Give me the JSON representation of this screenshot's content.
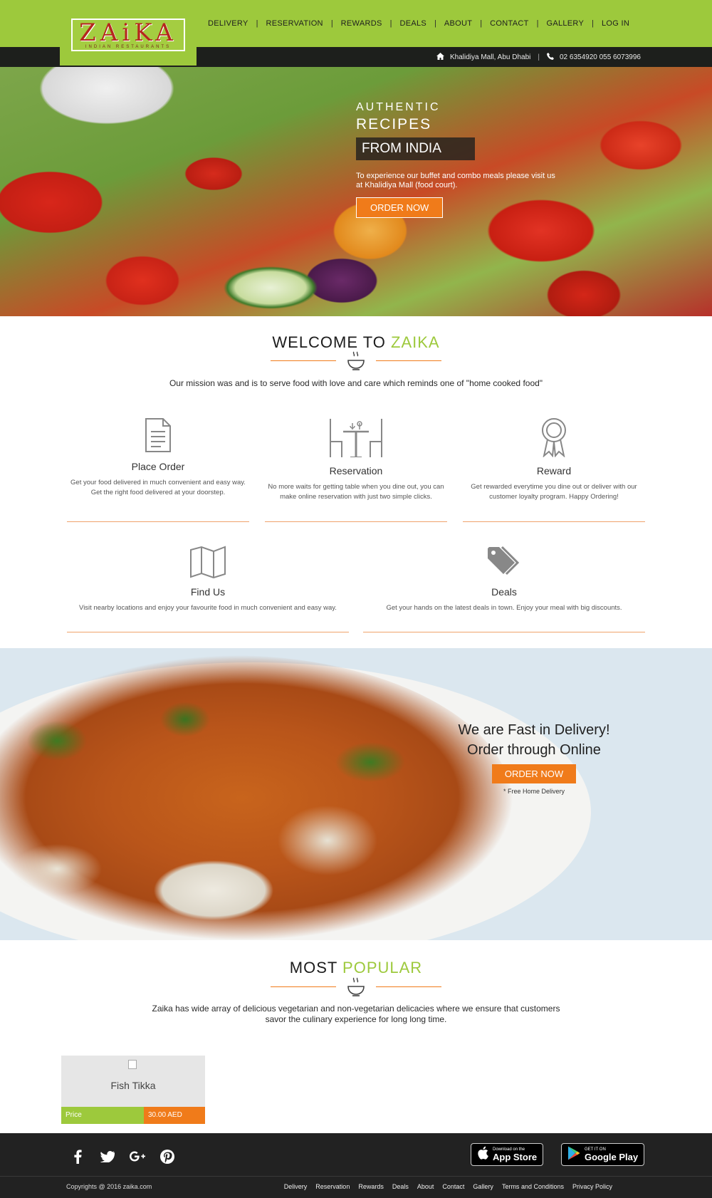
{
  "header": {
    "logo_title": "ZAiKA",
    "logo_subtitle": "INDIAN RESTAURANTS",
    "nav": [
      "DELIVERY",
      "RESERVATION",
      "REWARDS",
      "DEALS",
      "ABOUT",
      "CONTACT",
      "GALLERY",
      "LOG IN"
    ],
    "nav_separator": "|",
    "location": "Khalidiya Mall, Abu Dhabi",
    "info_separator": "|",
    "phone": "02 6354920  055 6073996",
    "colors": {
      "brand_green": "#9dc93c",
      "accent_orange": "#f07b1a",
      "dark": "#1d1f1c"
    }
  },
  "hero": {
    "line1": "AUTHENTIC",
    "line2": "RECIPES",
    "line3": "FROM INDIA",
    "description": "To experience our buffet and combo meals please visit us at Khalidiya Mall (food court).",
    "button": "ORDER NOW"
  },
  "welcome": {
    "title_a": "WELCOME TO ",
    "title_b": "ZAIKA",
    "mission": "Our mission was and is to serve food with love and care which reminds one of \"home cooked food\""
  },
  "features": [
    {
      "icon": "document-icon",
      "title": "Place Order",
      "desc": "Get your food delivered in much convenient and easy way. Get the right food delivered at your doorstep."
    },
    {
      "icon": "dining-table-icon",
      "title": "Reservation",
      "desc": "No more waits for getting table when you dine out, you can make online reservation with just two simple clicks."
    },
    {
      "icon": "award-ribbon-icon",
      "title": "Reward",
      "desc": "Get rewarded everytime you dine out or deliver with our customer loyalty program. Happy Ordering!"
    },
    {
      "icon": "map-icon",
      "title": "Find Us",
      "desc": "Visit nearby locations and enjoy your favourite food in much convenient and easy way."
    },
    {
      "icon": "tag-icon",
      "title": "Deals",
      "desc": "Get your hands on the latest deals in town. Enjoy your meal with big discounts."
    }
  ],
  "delivery": {
    "line1": "We are Fast in Delivery!",
    "line2": "Order through Online",
    "button": "ORDER NOW",
    "note": "* Free Home Delivery"
  },
  "popular": {
    "title_a": "MOST ",
    "title_b": "POPULAR",
    "desc": "Zaika has wide array of delicious vegetarian and non-vegetarian delicacies where we ensure that customers savor the culinary experience for long long time.",
    "items": [
      {
        "name": "Fish Tikka",
        "price_label": "Price",
        "price": "30.00 AED"
      }
    ]
  },
  "footer": {
    "social": [
      "facebook-icon",
      "twitter-icon",
      "google-plus-icon",
      "pinterest-icon"
    ],
    "app_store_small": "Download on the",
    "app_store_big": "App Store",
    "play_small": "GET IT ON",
    "play_big": "Google Play",
    "copyright": "Copyrights @ 2016 zaika.com",
    "links": [
      "Delivery",
      "Reservation",
      "Rewards",
      "Deals",
      "About",
      "Contact",
      "Gallery",
      "Terms and Conditions",
      "Privacy Policy"
    ]
  }
}
